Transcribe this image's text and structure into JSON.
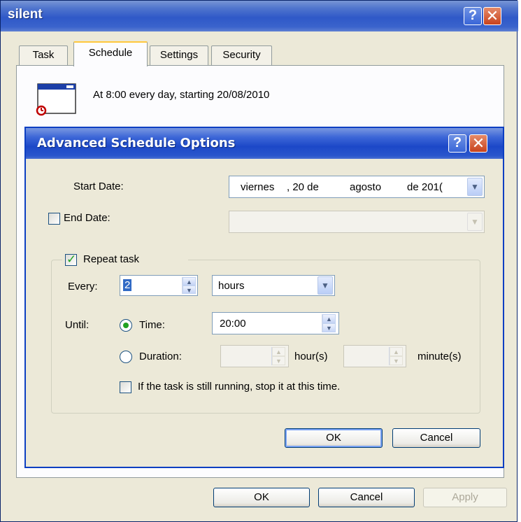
{
  "window": {
    "title": "silent"
  },
  "tabs": [
    "Task",
    "Schedule",
    "Settings",
    "Security"
  ],
  "schedule_summary": "At 8:00 every day, starting 20/08/2010",
  "dialog": {
    "title": "Advanced Schedule Options",
    "start_date_label": "Start Date:",
    "start_date": {
      "weekday": "viernes",
      "day": ", 20 de",
      "month": "agosto",
      "year": "de 201("
    },
    "end_date_label": "End Date:",
    "repeat_task_label": "Repeat task",
    "every_label": "Every:",
    "every_value": "2",
    "every_unit": "hours",
    "until_label": "Until:",
    "time_label": "Time:",
    "time_value": "20:00",
    "duration_label": "Duration:",
    "hours_label": "hour(s)",
    "minutes_label": "minute(s)",
    "stop_label": "If the task is still running, stop it at this time.",
    "ok": "OK",
    "cancel": "Cancel"
  },
  "footer": {
    "ok": "OK",
    "cancel": "Cancel",
    "apply": "Apply"
  },
  "icons": {
    "help": "?",
    "close": "✕",
    "dropdown": "▼",
    "spin_up": "▲",
    "spin_down": "▼"
  }
}
